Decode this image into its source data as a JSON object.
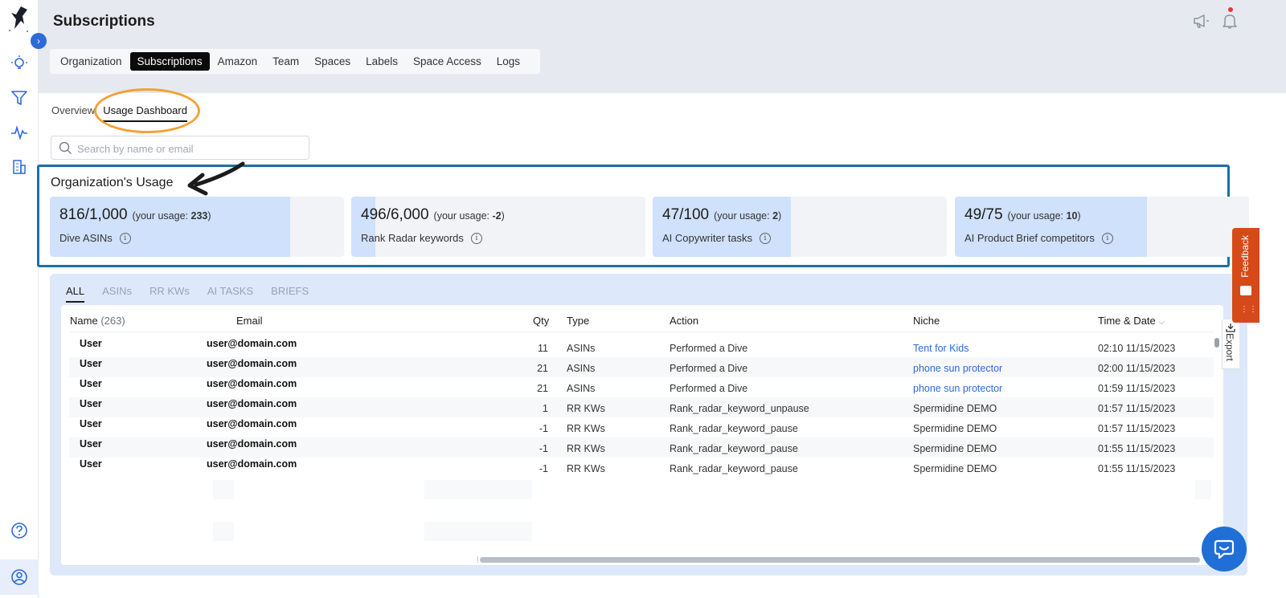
{
  "header": {
    "title": "Subscriptions",
    "nav_tabs": [
      {
        "label": "Organization",
        "active": false
      },
      {
        "label": "Subscriptions",
        "active": true
      },
      {
        "label": "Amazon",
        "active": false
      },
      {
        "label": "Team",
        "active": false
      },
      {
        "label": "Spaces",
        "active": false
      },
      {
        "label": "Labels",
        "active": false
      },
      {
        "label": "Space Access",
        "active": false
      },
      {
        "label": "Logs",
        "active": false
      }
    ],
    "icons": [
      "megaphone-icon",
      "bell-icon"
    ],
    "notification_dot_color": "#e53935"
  },
  "sidebar": {
    "icons": [
      "logo-icon",
      "expand-icon",
      "lightbulb-icon",
      "filter-icon",
      "activity-icon",
      "building-icon",
      "help-icon",
      "user-icon"
    ],
    "expand_glyph": "›"
  },
  "subtabs": [
    {
      "label": "Overview",
      "active": false
    },
    {
      "label": "Usage Dashboard",
      "active": true
    }
  ],
  "search": {
    "placeholder": "Search by name or email",
    "value": ""
  },
  "usage": {
    "title": "Organization's Usage",
    "your_usage_prefix": "(your usage: ",
    "your_usage_suffix": ")",
    "cards": [
      {
        "used": "816/1,000",
        "your_usage": "233",
        "label": "Dive ASINs",
        "fill_fraction": 0.816
      },
      {
        "used": "496/6,000",
        "your_usage": "-2",
        "label": "Rank Radar keywords",
        "fill_fraction": 0.083
      },
      {
        "used": "47/100",
        "your_usage": "2",
        "label": "AI Copywriter tasks",
        "fill_fraction": 0.47
      },
      {
        "used": "49/75",
        "your_usage": "10",
        "label": "AI Product Brief competitors",
        "fill_fraction": 0.653
      }
    ]
  },
  "activity": {
    "filter_tabs": [
      {
        "label": "ALL",
        "active": true
      },
      {
        "label": "ASINs",
        "active": false
      },
      {
        "label": "RR KWs",
        "active": false
      },
      {
        "label": "AI TASKS",
        "active": false
      },
      {
        "label": "BRIEFS",
        "active": false
      }
    ],
    "columns": {
      "name": "Name",
      "name_count": "(263)",
      "email": "Email",
      "qty": "Qty",
      "type": "Type",
      "action": "Action",
      "niche": "Niche",
      "time": "Time & Date"
    },
    "rows": [
      {
        "name": "User",
        "email": "user@domain.com",
        "qty": "11",
        "type": "ASINs",
        "action": "Performed a Dive",
        "niche": "Tent for Kids",
        "niche_link": true,
        "time": "02:10 11/15/2023"
      },
      {
        "name": "User",
        "email": "user@domain.com",
        "qty": "21",
        "type": "ASINs",
        "action": "Performed a Dive",
        "niche": "phone sun protector",
        "niche_link": true,
        "time": "02:00 11/15/2023"
      },
      {
        "name": "User",
        "email": "user@domain.com",
        "qty": "21",
        "type": "ASINs",
        "action": "Performed a Dive",
        "niche": "phone sun protector",
        "niche_link": true,
        "time": "01:59 11/15/2023"
      },
      {
        "name": "User",
        "email": "user@domain.com",
        "qty": "1",
        "type": "RR KWs",
        "action": "Rank_radar_keyword_unpause",
        "niche": "Spermidine DEMO",
        "niche_link": false,
        "time": "01:57 11/15/2023"
      },
      {
        "name": "User",
        "email": "user@domain.com",
        "qty": "-1",
        "type": "RR KWs",
        "action": "Rank_radar_keyword_pause",
        "niche": "Spermidine DEMO",
        "niche_link": false,
        "time": "01:57 11/15/2023"
      },
      {
        "name": "User",
        "email": "user@domain.com",
        "qty": "-1",
        "type": "RR KWs",
        "action": "Rank_radar_keyword_pause",
        "niche": "Spermidine DEMO",
        "niche_link": false,
        "time": "01:55 11/15/2023"
      },
      {
        "name": "User",
        "email": "user@domain.com",
        "qty": "-1",
        "type": "RR KWs",
        "action": "Rank_radar_keyword_pause",
        "niche": "Spermidine DEMO",
        "niche_link": false,
        "time": "01:55 11/15/2023"
      }
    ],
    "export_label": "Export"
  },
  "feedback": {
    "label": "Feedback",
    "color": "#d64a1a"
  },
  "colors": {
    "accent": "#2c6bd9",
    "highlight_box": "#1d6fa5",
    "annotation_ring": "#f5a035",
    "card_fill": "#cfe1fb",
    "panel_bg": "#dde8fa"
  }
}
